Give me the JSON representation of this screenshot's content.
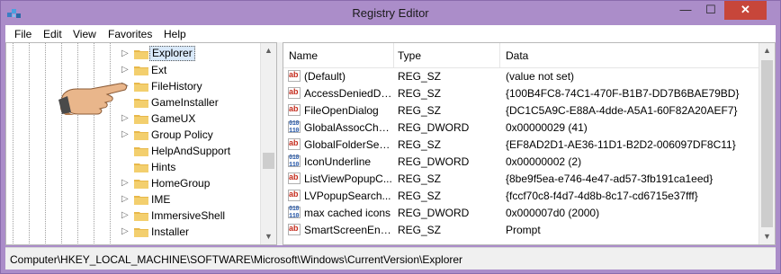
{
  "window": {
    "title": "Registry Editor",
    "close_label": "✕",
    "minimize_label": "—",
    "maximize_label": "☐"
  },
  "menu": [
    "File",
    "Edit",
    "View",
    "Favorites",
    "Help"
  ],
  "tree": {
    "items": [
      {
        "label": "Explorer",
        "selected": true
      },
      {
        "label": "Ext",
        "selected": false
      },
      {
        "label": "FileHistory",
        "selected": false
      },
      {
        "label": "GameInstaller",
        "selected": false
      },
      {
        "label": "GameUX",
        "selected": false
      },
      {
        "label": "Group Policy",
        "selected": false
      },
      {
        "label": "HelpAndSupport",
        "selected": false
      },
      {
        "label": "Hints",
        "selected": false
      },
      {
        "label": "HomeGroup",
        "selected": false
      },
      {
        "label": "IME",
        "selected": false
      },
      {
        "label": "ImmersiveShell",
        "selected": false
      },
      {
        "label": "Installer",
        "selected": false
      }
    ]
  },
  "list": {
    "columns": {
      "name": "Name",
      "type": "Type",
      "data": "Data"
    },
    "rows": [
      {
        "icon": "string-value-icon",
        "name": "(Default)",
        "type": "REG_SZ",
        "data": "(value not set)"
      },
      {
        "icon": "string-value-icon",
        "name": "AccessDeniedDi...",
        "type": "REG_SZ",
        "data": "{100B4FC8-74C1-470F-B1B7-DD7B6BAE79BD}"
      },
      {
        "icon": "string-value-icon",
        "name": "FileOpenDialog",
        "type": "REG_SZ",
        "data": "{DC1C5A9C-E88A-4dde-A5A1-60F82A20AEF7}"
      },
      {
        "icon": "dword-value-icon",
        "name": "GlobalAssocCha...",
        "type": "REG_DWORD",
        "data": "0x00000029 (41)"
      },
      {
        "icon": "string-value-icon",
        "name": "GlobalFolderSett...",
        "type": "REG_SZ",
        "data": "{EF8AD2D1-AE36-11D1-B2D2-006097DF8C11}"
      },
      {
        "icon": "dword-value-icon",
        "name": "IconUnderline",
        "type": "REG_DWORD",
        "data": "0x00000002 (2)"
      },
      {
        "icon": "string-value-icon",
        "name": "ListViewPopupC...",
        "type": "REG_SZ",
        "data": "{8be9f5ea-e746-4e47-ad57-3fb191ca1eed}"
      },
      {
        "icon": "string-value-icon",
        "name": "LVPopupSearch...",
        "type": "REG_SZ",
        "data": "{fccf70c8-f4d7-4d8b-8c17-cd6715e37fff}"
      },
      {
        "icon": "dword-value-icon",
        "name": "max cached icons",
        "type": "REG_DWORD",
        "data": "0x000007d0 (2000)"
      },
      {
        "icon": "string-value-icon",
        "name": "SmartScreenEna...",
        "type": "REG_SZ",
        "data": "Prompt"
      }
    ]
  },
  "status": {
    "path": "Computer\\HKEY_LOCAL_MACHINE\\SOFTWARE\\Microsoft\\Windows\\CurrentVersion\\Explorer"
  },
  "icons": {
    "string": "ab",
    "dword": "010\n110"
  },
  "colors": {
    "title_bg": "#ab8dc9",
    "close_btn": "#c7463a",
    "folder": "#e8b84a",
    "selection": "#d9e9fa"
  }
}
